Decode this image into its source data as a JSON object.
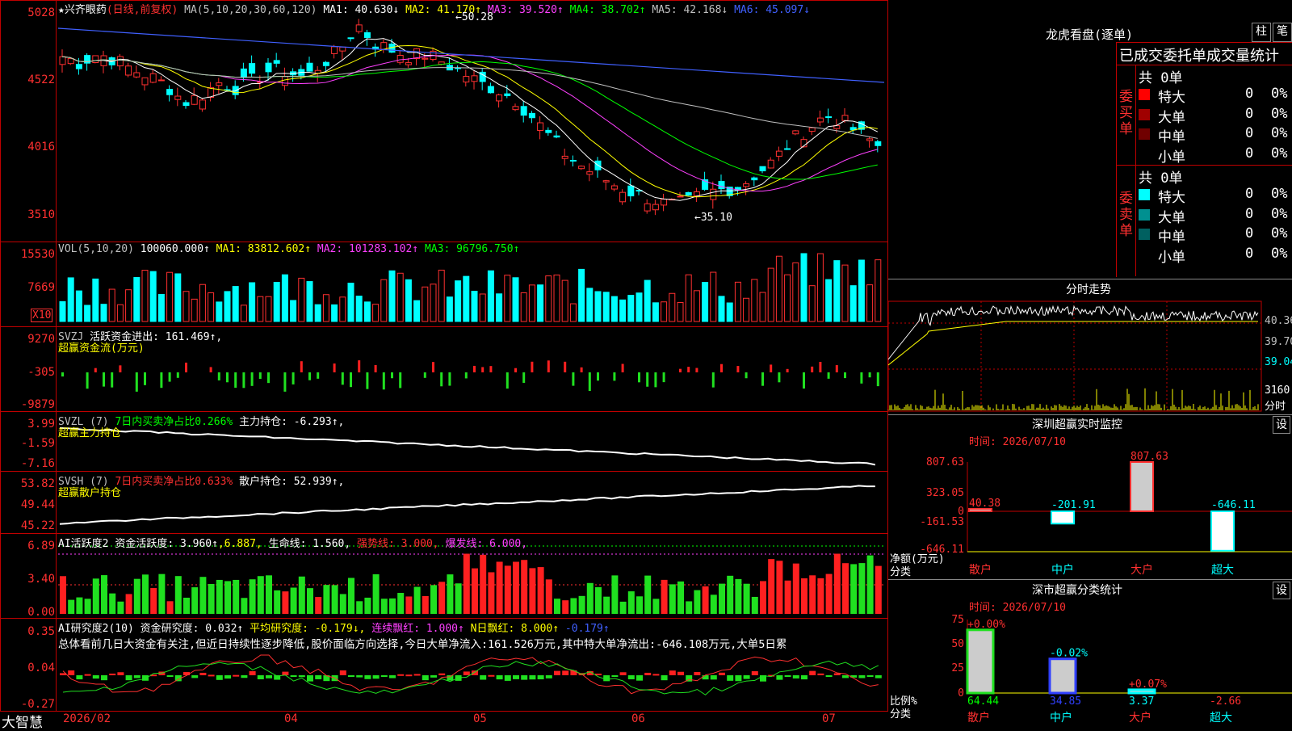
{
  "main": {
    "title": "★兴齐眼药",
    "mode": "(日线,前复权)",
    "ma_label": "MA(5,10,20,30,60,120)",
    "ma": [
      {
        "name": "MA1:",
        "value": "40.630↓",
        "color": "#ffffff"
      },
      {
        "name": "MA2:",
        "value": "41.170↑",
        "color": "#ffff00"
      },
      {
        "name": "MA3:",
        "value": "39.520↑",
        "color": "#ff40ff"
      },
      {
        "name": "MA4:",
        "value": "38.702↑",
        "color": "#00ff00"
      },
      {
        "name": "MA5:",
        "value": "42.168↓",
        "color": "#c0c0c0"
      },
      {
        "name": "MA6:",
        "value": "45.097↓",
        "color": "#4060ff"
      }
    ],
    "high_marker": "50.28",
    "low_marker": "35.10",
    "y_ticks": [
      "5028",
      "4522",
      "4016",
      "3510"
    ]
  },
  "volume": {
    "label": "VOL(5,10,20)",
    "value": "100060.000↑",
    "ma": [
      {
        "name": "MA1:",
        "value": "83812.602↑",
        "color": "#ffff00"
      },
      {
        "name": "MA2:",
        "value": "101283.102↑",
        "color": "#ff40ff"
      },
      {
        "name": "MA3:",
        "value": "96796.750↑",
        "color": "#00ff00"
      }
    ],
    "y_ticks": [
      "15530",
      "7669"
    ],
    "unit": "X10"
  },
  "svzj": {
    "label": "SVZJ",
    "desc": "活跃资金进出:",
    "value": "161.469↑,",
    "sub": "超赢资金流(万元)",
    "y_ticks": [
      "9270",
      "-305",
      "-9879"
    ]
  },
  "svzl": {
    "label": "SVZL (7)",
    "desc": "7日内买卖净占比0.266%",
    "desc2": "主力持仓:",
    "value": "-6.293↑,",
    "sub": "超赢主力持仓",
    "y_ticks": [
      "3.99",
      "-1.59",
      "-7.16"
    ]
  },
  "svsh": {
    "label": "SVSH (7)",
    "desc": "7日内买卖净占比0.633%",
    "desc2": "散户持仓:",
    "value": "52.939↑,",
    "sub": "超赢散户持仓",
    "y_ticks": [
      "53.82",
      "49.44",
      "45.22"
    ]
  },
  "ai1": {
    "label": "AI活跃度2",
    "desc": "资金活跃度:",
    "v1": "3.960↑",
    "v2": ",6.887,",
    "desc2": "生命线:",
    "v3": "1.560,",
    "strong": "强势线: 3.000,",
    "burst": "爆发线: 6.000,",
    "y_ticks": [
      "6.89",
      "3.40",
      "0.00"
    ]
  },
  "ai2": {
    "label": "AI研究度2(10)",
    "desc": "资金研究度:",
    "v1": "0.032↑",
    "avg": "平均研究度: -0.179↓,",
    "cont": "连续飘红: 1.000↑",
    "n": "N日飘红: 8.000↑",
    "v2": "-0.179↑",
    "summary": "总体看前几日大资金有关注,但近日持续性逐步降低,股价面临方向选择,今日大单净流入:161.526万元,其中特大单净流出:-646.108万元,大单5日累",
    "y_ticks": [
      "0.35",
      "0.04",
      "-0.27"
    ]
  },
  "x_axis": {
    "labels": [
      "2026/02",
      "04",
      "05",
      "06",
      "07"
    ],
    "brand": "大智慧"
  },
  "dragon": {
    "title": "龙虎看盘(逐单)",
    "btn1": "柱",
    "btn2": "笔",
    "header": "已成交委托单成交量统计",
    "buy": {
      "label": "委买单",
      "total": "共 0单",
      "rows": [
        {
          "name": "特大",
          "color": "#ff0000",
          "n": "0",
          "pct": "0%"
        },
        {
          "name": "大单",
          "color": "#a00000",
          "n": "0",
          "pct": "0%"
        },
        {
          "name": "中单",
          "color": "#700000",
          "n": "0",
          "pct": "0%"
        },
        {
          "name": "小单",
          "color": "#000000",
          "n": "0",
          "pct": "0%"
        }
      ]
    },
    "sell": {
      "label": "委卖单",
      "total": "共 0单",
      "rows": [
        {
          "name": "特大",
          "color": "#00ffff",
          "n": "0",
          "pct": "0%"
        },
        {
          "name": "大单",
          "color": "#009090",
          "n": "0",
          "pct": "0%"
        },
        {
          "name": "中单",
          "color": "#006060",
          "n": "0",
          "pct": "0%"
        },
        {
          "name": "小单",
          "color": "#000000",
          "n": "0",
          "pct": "0%"
        }
      ]
    }
  },
  "intraday": {
    "title": "分时走势",
    "y_ticks": [
      "40.36",
      "39.70",
      "39.04"
    ],
    "vol_tick": "3160",
    "unit": "分时"
  },
  "monitor": {
    "title": "深圳超赢实时监控",
    "btn": "设",
    "time": "时间: 2026/07/10",
    "y_ticks": [
      "807.63",
      "323.05",
      "0",
      "-161.53",
      "-646.11"
    ],
    "unit": "净额(万元)",
    "unit2": "分类",
    "categories": [
      "散户",
      "中户",
      "大户",
      "超大"
    ],
    "values": [
      "40.38",
      "-201.91",
      "807.63",
      "-646.11"
    ]
  },
  "classify": {
    "title": "深市超赢分类统计",
    "btn": "设",
    "time": "时间: 2026/07/10",
    "y_ticks": [
      "75",
      "50",
      "25",
      "0"
    ],
    "unit": "比例%",
    "unit2": "分类",
    "categories": [
      "散户",
      "中户",
      "大户",
      "超大"
    ],
    "top": [
      "+0.00%",
      "-0.02%",
      "+0.07%",
      ""
    ],
    "bottom": [
      "64.44",
      "34.85",
      "3.37",
      "-2.66"
    ]
  }
}
